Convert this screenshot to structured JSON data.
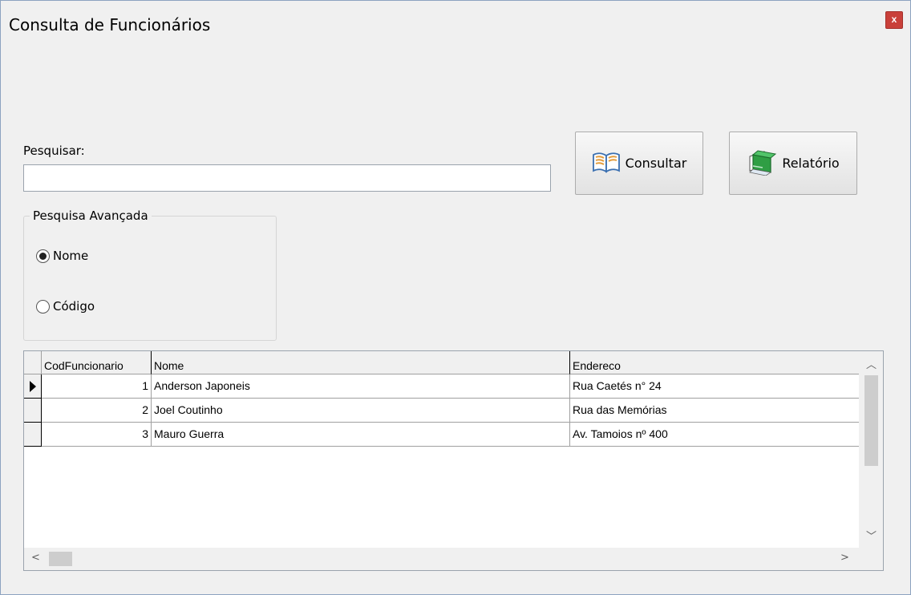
{
  "window": {
    "title": "Consulta de Funcionários",
    "close_label": "x"
  },
  "search": {
    "label": "Pesquisar:",
    "value": "",
    "placeholder": ""
  },
  "buttons": {
    "consultar_label": "Consultar",
    "relatorio_label": "Relatório"
  },
  "advanced": {
    "title": "Pesquisa Avançada",
    "options": [
      {
        "label": "Nome",
        "checked": true
      },
      {
        "label": "Código",
        "checked": false
      }
    ]
  },
  "grid": {
    "columns": [
      "CodFuncionario",
      "Nome",
      "Endereco"
    ],
    "rows": [
      {
        "cod": "1",
        "nome": "Anderson Japoneis",
        "endereco": "Rua Caetés n° 24",
        "current": true
      },
      {
        "cod": "2",
        "nome": "Joel Coutinho",
        "endereco": "Rua das Memórias",
        "current": false
      },
      {
        "cod": "3",
        "nome": "Mauro Guerra",
        "endereco": "Av. Tamoios nº 400",
        "current": false
      }
    ]
  },
  "icons": {
    "consultar": "open-book-icon",
    "relatorio": "green-report-book-icon"
  },
  "colors": {
    "close_button": "#c9403a",
    "window_bg": "#f0f0f0"
  }
}
